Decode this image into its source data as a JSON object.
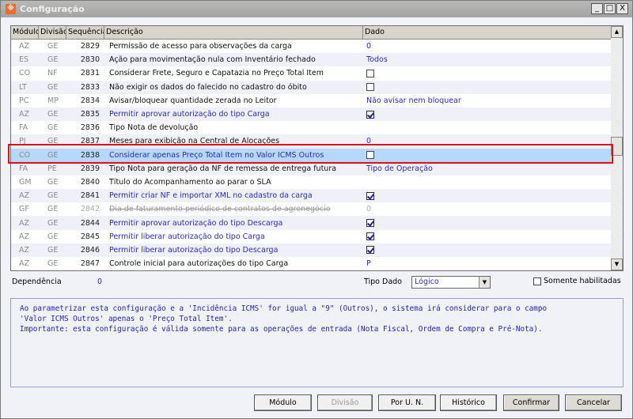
{
  "window": {
    "title": "Configuração",
    "minimize": "_",
    "maximize": "□",
    "close": "X"
  },
  "grid": {
    "columns": [
      "Módulo",
      "Divisão",
      "Sequência",
      "Descrição",
      "Dado"
    ],
    "rows": [
      {
        "modulo": "AZ",
        "divisao": "GE",
        "seq": "2829",
        "desc": "Permissão de acesso para observações da carga",
        "style": "black",
        "dado": "0",
        "dado_type": "text"
      },
      {
        "modulo": "ES",
        "divisao": "GE",
        "seq": "2830",
        "desc": "Ação para movimentação nula com Inventário fechado",
        "style": "black",
        "dado": "Todos",
        "dado_type": "text"
      },
      {
        "modulo": "CO",
        "divisao": "NF",
        "seq": "2831",
        "desc": "Considerar Frete, Seguro e Capatazia no Preço Total Item",
        "style": "black",
        "dado": false,
        "dado_type": "check"
      },
      {
        "modulo": "LT",
        "divisao": "GE",
        "seq": "2833",
        "desc": "Não exigir os dados do falecido no cadastro do óbito",
        "style": "black",
        "dado": false,
        "dado_type": "check"
      },
      {
        "modulo": "PC",
        "divisao": "MP",
        "seq": "2834",
        "desc": "Avisar/bloquear quantidade zerada no Leitor",
        "style": "black",
        "dado": "Não avisar nem bloquear",
        "dado_type": "text"
      },
      {
        "modulo": "AZ",
        "divisao": "GE",
        "seq": "2835",
        "desc": "Permitir aprovar autorização do tipo Carga",
        "style": "blue",
        "dado": true,
        "dado_type": "check"
      },
      {
        "modulo": "FA",
        "divisao": "GE",
        "seq": "2836",
        "desc": "Tipo Nota de devolução",
        "style": "black",
        "dado": "",
        "dado_type": "text"
      },
      {
        "modulo": "PJ",
        "divisao": "GE",
        "seq": "2837",
        "desc": "Meses para exibição na Central de Alocações",
        "style": "black",
        "dado": "0",
        "dado_type": "text"
      },
      {
        "modulo": "CO",
        "divisao": "GE",
        "seq": "2838",
        "desc": "Considerar apenas Preço Total Item no Valor ICMS Outros",
        "style": "blue",
        "dado": false,
        "dado_type": "check",
        "selected": true
      },
      {
        "modulo": "FA",
        "divisao": "PE",
        "seq": "2839",
        "desc": "Tipo Nota para geração da NF de remessa de entrega futura",
        "style": "black",
        "dado": "Tipo de Operação",
        "dado_type": "text"
      },
      {
        "modulo": "GM",
        "divisao": "GE",
        "seq": "2840",
        "desc": "Título do Acompanhamento ao parar o SLA",
        "style": "black",
        "dado": "",
        "dado_type": "text"
      },
      {
        "modulo": "AZ",
        "divisao": "GE",
        "seq": "2841",
        "desc": "Permitir criar NF e importar XML no cadastro da carga",
        "style": "blue",
        "dado": true,
        "dado_type": "check"
      },
      {
        "modulo": "GF",
        "divisao": "GE",
        "seq": "2842",
        "desc": "Dia de faturamento periódico de contratos de agronegócio",
        "style": "strike",
        "dado": "0",
        "dado_type": "text"
      },
      {
        "modulo": "AZ",
        "divisao": "GE",
        "seq": "2844",
        "desc": "Permitir aprovar autorização do tipo Descarga",
        "style": "blue",
        "dado": true,
        "dado_type": "check"
      },
      {
        "modulo": "AZ",
        "divisao": "GE",
        "seq": "2845",
        "desc": "Permitir liberar autorização do tipo Carga",
        "style": "blue",
        "dado": true,
        "dado_type": "check"
      },
      {
        "modulo": "AZ",
        "divisao": "GE",
        "seq": "2846",
        "desc": "Permitir liberar autorização do tipo Descarga",
        "style": "blue",
        "dado": true,
        "dado_type": "check"
      },
      {
        "modulo": "AZ",
        "divisao": "GE",
        "seq": "2847",
        "desc": "Controle inicial para autorizações do tipo Carga",
        "style": "black",
        "dado": "P",
        "dado_type": "text"
      }
    ]
  },
  "footer": {
    "dependencia_label": "Dependência",
    "dependencia_value": "0",
    "tipo_dado_label": "Tipo Dado",
    "tipo_dado_value": "Lógico",
    "somente_label": "Somente habilitadas",
    "help": "Ao parametrizar esta configuração e a 'Incidência ICMS' for igual a \"9\" (Outros), o sistema irá considerar para o campo\n'Valor ICMS Outros' apenas o 'Preço Total Item'.\nImportante: esta configuração é válida somente para as operações de entrada (Nota Fiscal, Ordem de Compra e Pré-Nota)."
  },
  "buttons": {
    "modulo": "Módulo",
    "divisao": "Divisão",
    "por_un": "Por U. N.",
    "historico": "Histórico",
    "confirmar": "Confirmar",
    "cancelar": "Cancelar"
  }
}
